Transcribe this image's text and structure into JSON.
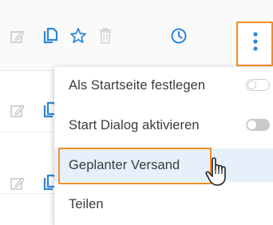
{
  "colors": {
    "accent_orange": "#f28c28",
    "icon_blue": "#2f86d6",
    "icon_grey": "#c8c8c8",
    "hover_bg": "#e6f0fb",
    "text": "#3b3b3b"
  },
  "row_toolbar": {
    "icons": [
      "edit-icon",
      "copy-icon",
      "star-icon",
      "trash-icon",
      "clock-icon",
      "more-vertical-icon"
    ]
  },
  "context_menu": {
    "items": [
      {
        "label": "Als Startseite festlegen",
        "toggle": "off"
      },
      {
        "label": "Start Dialog aktivieren",
        "toggle": "off"
      },
      {
        "label": "Geplanter Versand",
        "state": "hovered"
      },
      {
        "label": "Teilen"
      }
    ]
  },
  "cursor": "hand-pointer-icon"
}
